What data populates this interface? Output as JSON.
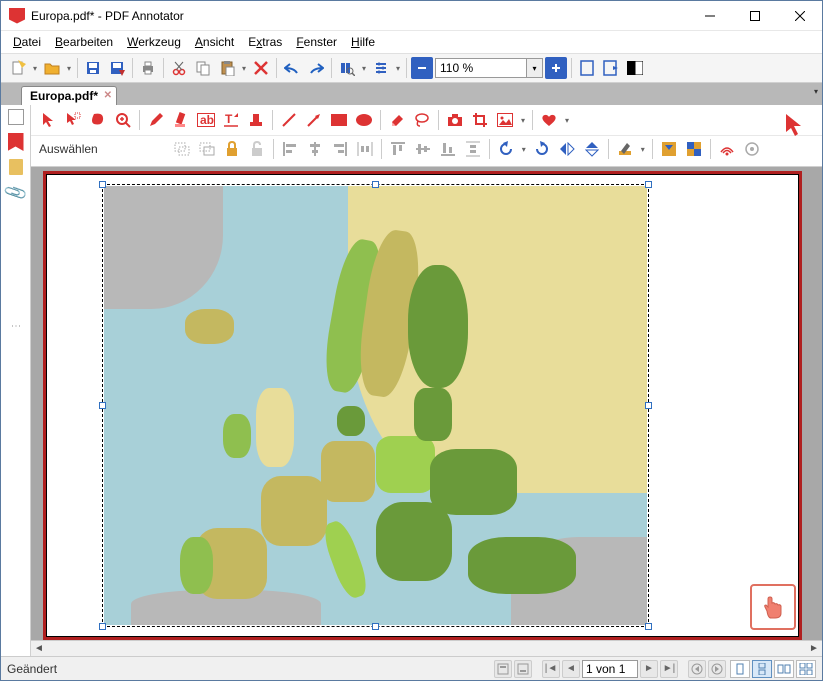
{
  "app": {
    "title": "Europa.pdf* - PDF Annotator"
  },
  "menus": {
    "file": "Datei",
    "edit": "Bearbeiten",
    "tool": "Werkzeug",
    "view": "Ansicht",
    "extras": "Extras",
    "window": "Fenster",
    "help": "Hilfe"
  },
  "toolbar": {
    "zoom_value": "110 %"
  },
  "tab": {
    "label": "Europa.pdf*"
  },
  "subtoolbar": {
    "select_label": "Auswählen"
  },
  "status": {
    "modified": "Geändert",
    "page_text": "1 von 1"
  }
}
